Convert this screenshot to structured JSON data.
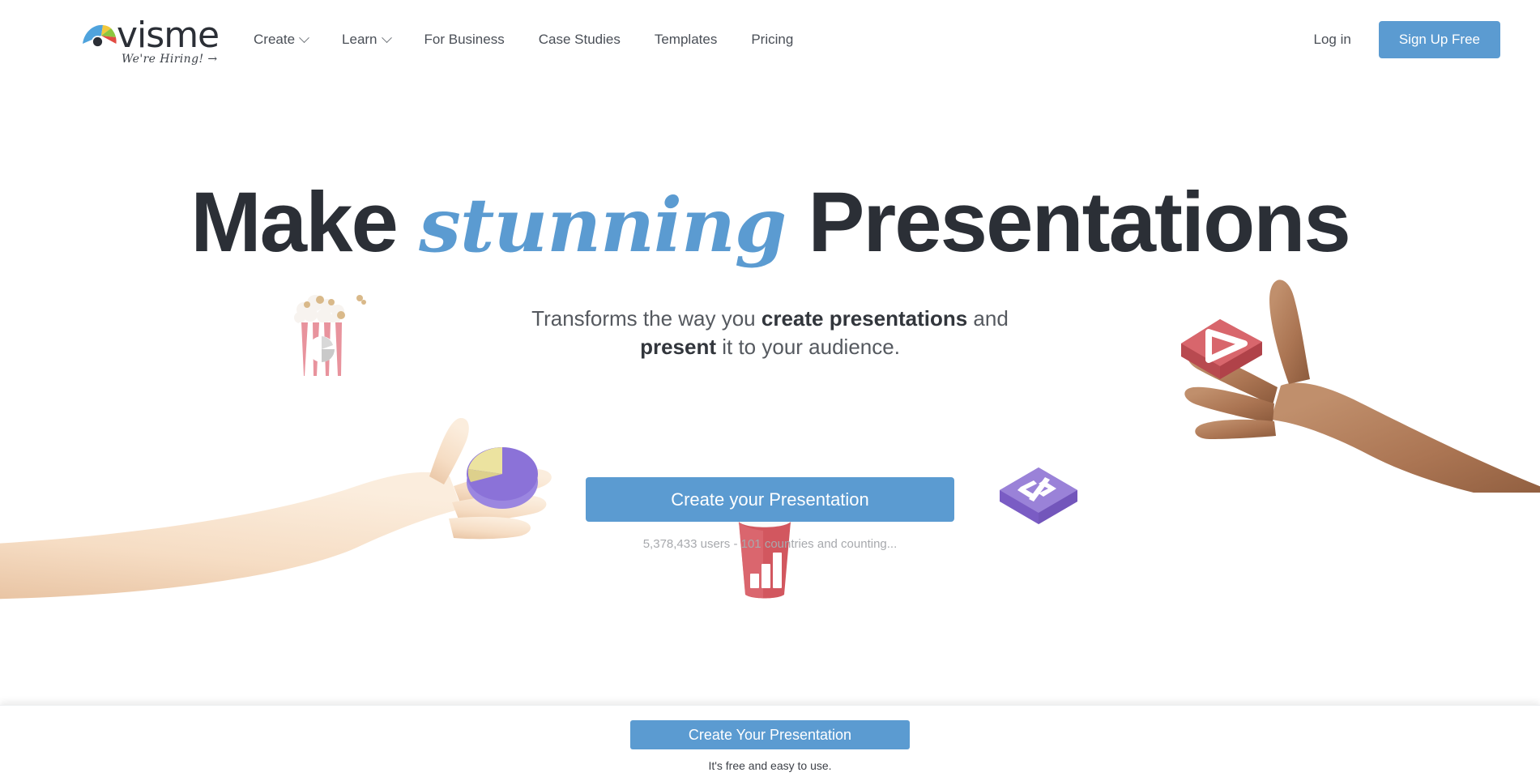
{
  "brand": {
    "name": "visme",
    "tagline": "We're Hiring! →",
    "logo_icon": "visme-fan-eye-logo",
    "accent_color": "#5b9bd1",
    "text_color": "#2b2f36"
  },
  "nav": {
    "items": [
      {
        "label": "Create",
        "has_dropdown": true
      },
      {
        "label": "Learn",
        "has_dropdown": true
      },
      {
        "label": "For Business",
        "has_dropdown": false
      },
      {
        "label": "Case Studies",
        "has_dropdown": false
      },
      {
        "label": "Templates",
        "has_dropdown": false
      },
      {
        "label": "Pricing",
        "has_dropdown": false
      }
    ],
    "login_label": "Log in",
    "signup_label": "Sign Up Free"
  },
  "hero": {
    "headline_part1": "Make",
    "headline_script": "stunning",
    "headline_part2": "Presentations",
    "subhead_1": "Transforms the way you ",
    "subhead_bold_1": "create presentations",
    "subhead_2": " and",
    "subhead_bold_2": "present",
    "subhead_3": " it to your audience.",
    "cta_label": "Create your Presentation",
    "social_proof": "5,378,433 users - 101 countries and counting...",
    "illustrations": [
      {
        "name": "popcorn-box-with-pie-chart",
        "colors": [
          "#e8a3ab",
          "#ffffff",
          "#d9b98a"
        ]
      },
      {
        "name": "soda-cup-with-bar-chart",
        "colors": [
          "#d9636b",
          "#ffffff"
        ]
      },
      {
        "name": "pie-chart-3d",
        "colors": [
          "#8a72d6",
          "#eee6a3"
        ]
      },
      {
        "name": "purple-cube-code-icon",
        "colors": [
          "#8a6fd1",
          "#ffffff"
        ]
      },
      {
        "name": "red-cube-play-icon",
        "colors": [
          "#cf5a5e",
          "#ffffff"
        ]
      },
      {
        "name": "left-arm-light-skin",
        "colors": [
          "#f2d6bb"
        ]
      },
      {
        "name": "right-arm-dark-skin",
        "colors": [
          "#a9714f"
        ]
      }
    ]
  },
  "sticky_footer": {
    "cta_label": "Create Your Presentation",
    "note": "It's free and easy to use."
  }
}
